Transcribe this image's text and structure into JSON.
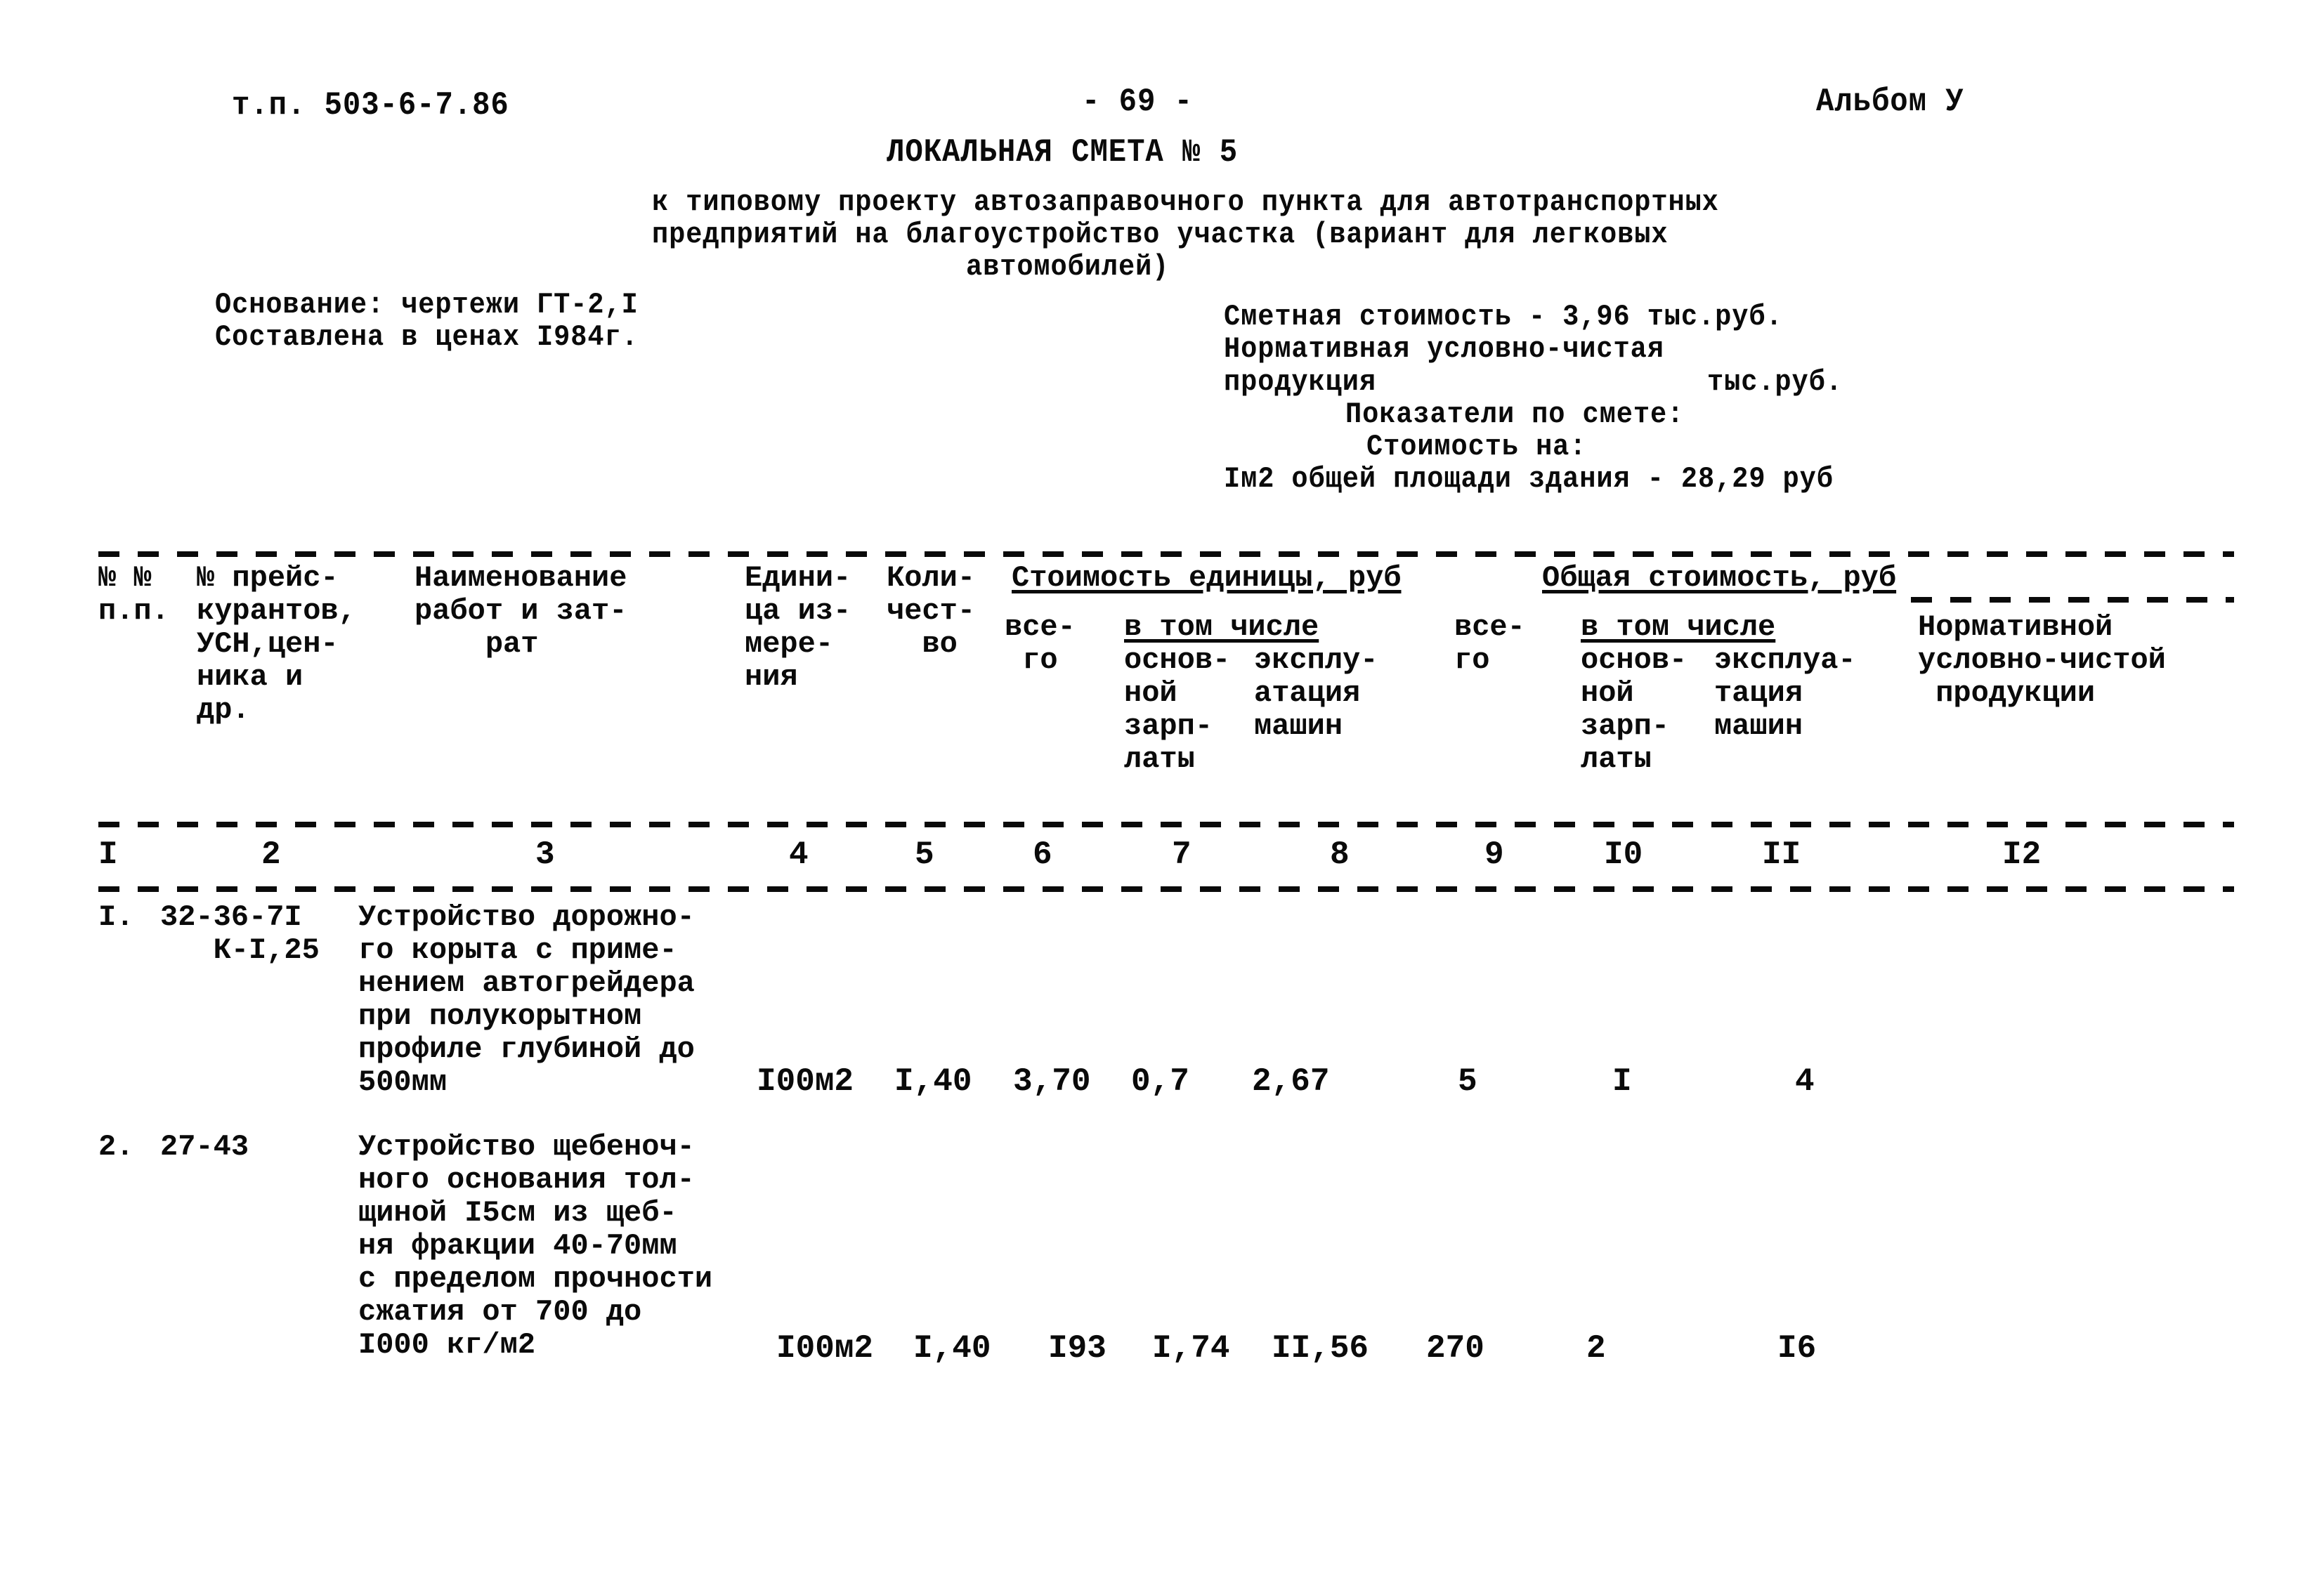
{
  "page_header": {
    "project_code": "т.п. 503-6-7.86",
    "page_number": "- 69 -",
    "album": "Альбом У"
  },
  "title": "ЛОКАЛЬНАЯ СМЕТА № 5",
  "subtitle": {
    "line1": "к типовому проекту автозаправочного пункта для автотранспортных",
    "line2": "предприятий на благоустройство участка (вариант для легковых",
    "line3": "автомобилей)"
  },
  "basis": {
    "line1": "Основание: чертежи ГТ-2,I",
    "line2": "Составлена в ценах I984г."
  },
  "summary": {
    "estimated_cost": "Сметная стоимость - 3,96 тыс.руб.",
    "normative_line1": "Нормативная условно-чистая",
    "normative_line2_label": "продукция",
    "normative_line2_unit": "тыс.руб.",
    "indicators": "Показатели по смете:",
    "cost_on": "Стоимость на:",
    "per_m2": "Iм2 общей площади здания - 28,29 руб"
  },
  "table": {
    "headers": {
      "c1": "№ №\nп.п.",
      "c2": "№ прейс-\nкурантов,\nУСН,цен-\nника и\nдр.",
      "c3": "Наименование\nработ и зат-\n    рат",
      "c4": "Едини-\nца из-\nмере-\nния",
      "c5": "Коли-\nчест-\n  во",
      "unit_cost_group": "Стоимость единицы, руб",
      "c6": "все-\n го",
      "including_unit": "в том числе",
      "c7": "основ-\nной\nзарп-\nлаты",
      "c8": "эксплу-\nатация\nмашин",
      "total_cost_group": "Общая стоимость, руб",
      "c9": "все-\nго",
      "including_total": "в том числе",
      "c10": "основ-\nной\nзарп-\nлаты",
      "c11": "эксплуа-\nтация\nмашин",
      "c12": "Нормативной\nусловно-чистой\n продукции"
    },
    "column_numbers": [
      "I",
      "2",
      "3",
      "4",
      "5",
      "6",
      "7",
      "8",
      "9",
      "I0",
      "II",
      "I2"
    ],
    "rows": [
      {
        "no": "I.",
        "price_ref": "32-36-7I\n   К-I,25",
        "description": "Устройство дорожно-\nго корыта с приме-\nнением автогрейдера\nпри полукорытном\nпрофиле глубиной до\n500мм",
        "unit": "I00м2",
        "quantity": "I,40",
        "unit_total": "3,70",
        "unit_wages": "0,7",
        "unit_machines": "2,67",
        "total": "5",
        "total_wages": "I",
        "total_machines": "4",
        "normative": ""
      },
      {
        "no": "2.",
        "price_ref": "27-43",
        "description": "Устройство щебеноч-\nного основания тол-\nщиной I5см из щеб-\nня фракции 40-70мм\nс пределом прочности\nсжатия от 700 до\nI000 кг/м2",
        "unit": "I00м2",
        "quantity": "I,40",
        "unit_total": "I93",
        "unit_wages": "I,74",
        "unit_machines": "II,56",
        "total": "270",
        "total_wages": "2",
        "total_machines": "I6",
        "normative": ""
      }
    ]
  }
}
